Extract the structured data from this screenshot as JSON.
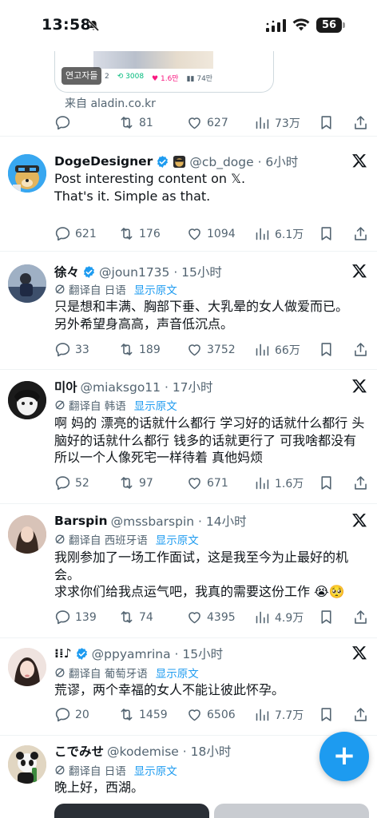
{
  "status_bar": {
    "time": "13:58",
    "battery": "56"
  },
  "top_tweet": {
    "card_badge": "연고자들",
    "card_stats": [
      "2",
      "3008",
      "1.6만",
      "74만"
    ],
    "card_source": "来自 aladin.co.kr",
    "actions": {
      "reply": "",
      "retweet": "81",
      "like": "627",
      "views": "73万"
    }
  },
  "tweets": [
    {
      "name": "DogeDesigner",
      "handle": "@cb_doge · 6小时",
      "text": [
        "Post interesting content on 𝕏.",
        "",
        "That's it. Simple as that."
      ],
      "actions": {
        "reply": "621",
        "retweet": "176",
        "like": "1094",
        "views": "6.1万"
      }
    },
    {
      "name": "徐々",
      "handle": "@joun1735 · 15小时",
      "translated": "翻译自 日语",
      "show_original": "显示原文",
      "text": [
        "只是想和丰满、胸部下垂、大乳晕的女人做爱而已。",
        "另外希望身高高，声音低沉点。"
      ],
      "actions": {
        "reply": "33",
        "retweet": "189",
        "like": "3752",
        "views": "66万"
      }
    },
    {
      "name": "미아",
      "handle": "@miaksgo11 · 17小时",
      "translated": "翻译自 韩语",
      "show_original": "显示原文",
      "text": [
        "啊 妈的 漂亮的话就什么都行 学习好的话就什么都行 头",
        "脑好的话就什么都行 钱多的话就更行了 可我啥都没有",
        "所以一个人像死宅一样待着 真他妈烦"
      ],
      "actions": {
        "reply": "52",
        "retweet": "97",
        "like": "671",
        "views": "1.6万"
      }
    },
    {
      "name": "Barspin",
      "handle": "@mssbarspin · 14小时",
      "translated": "翻译自 西班牙语",
      "show_original": "显示原文",
      "text": [
        "我刚参加了一场工作面试，这是我至今为止最好的机",
        "会。",
        "求求你们给我点运气吧，我真的需要这份工作 😭🥺"
      ],
      "actions": {
        "reply": "139",
        "retweet": "74",
        "like": "4395",
        "views": "4.9万"
      }
    },
    {
      "name": "⁝⁞♪",
      "handle": "@ppyamrina · 15小时",
      "translated": "翻译自 葡萄牙语",
      "show_original": "显示原文",
      "text": [
        "荒谬，两个幸福的女人不能让彼此怀孕。"
      ],
      "actions": {
        "reply": "20",
        "retweet": "1459",
        "like": "6506",
        "views": "7.7万"
      }
    },
    {
      "name": "こでみせ",
      "handle": "@kodemise · 18小时",
      "translated": "翻译自 日语",
      "show_original": "显示原文",
      "text": [
        "晚上好，西湖。"
      ]
    }
  ],
  "colors": {
    "accent": "#1d9bf0",
    "muted": "#536471",
    "text": "#0f1419",
    "verified": "#1d9bf0",
    "retweet": "#00ba7c",
    "like": "#f91880"
  },
  "icons": [
    "bell-slash-icon",
    "signal-icon",
    "wifi-icon",
    "battery-icon",
    "verified-badge-icon",
    "x-logo-icon",
    "translate-icon",
    "reply-icon",
    "retweet-icon",
    "like-icon",
    "views-icon",
    "bookmark-icon",
    "share-icon",
    "compose-plus-icon"
  ]
}
